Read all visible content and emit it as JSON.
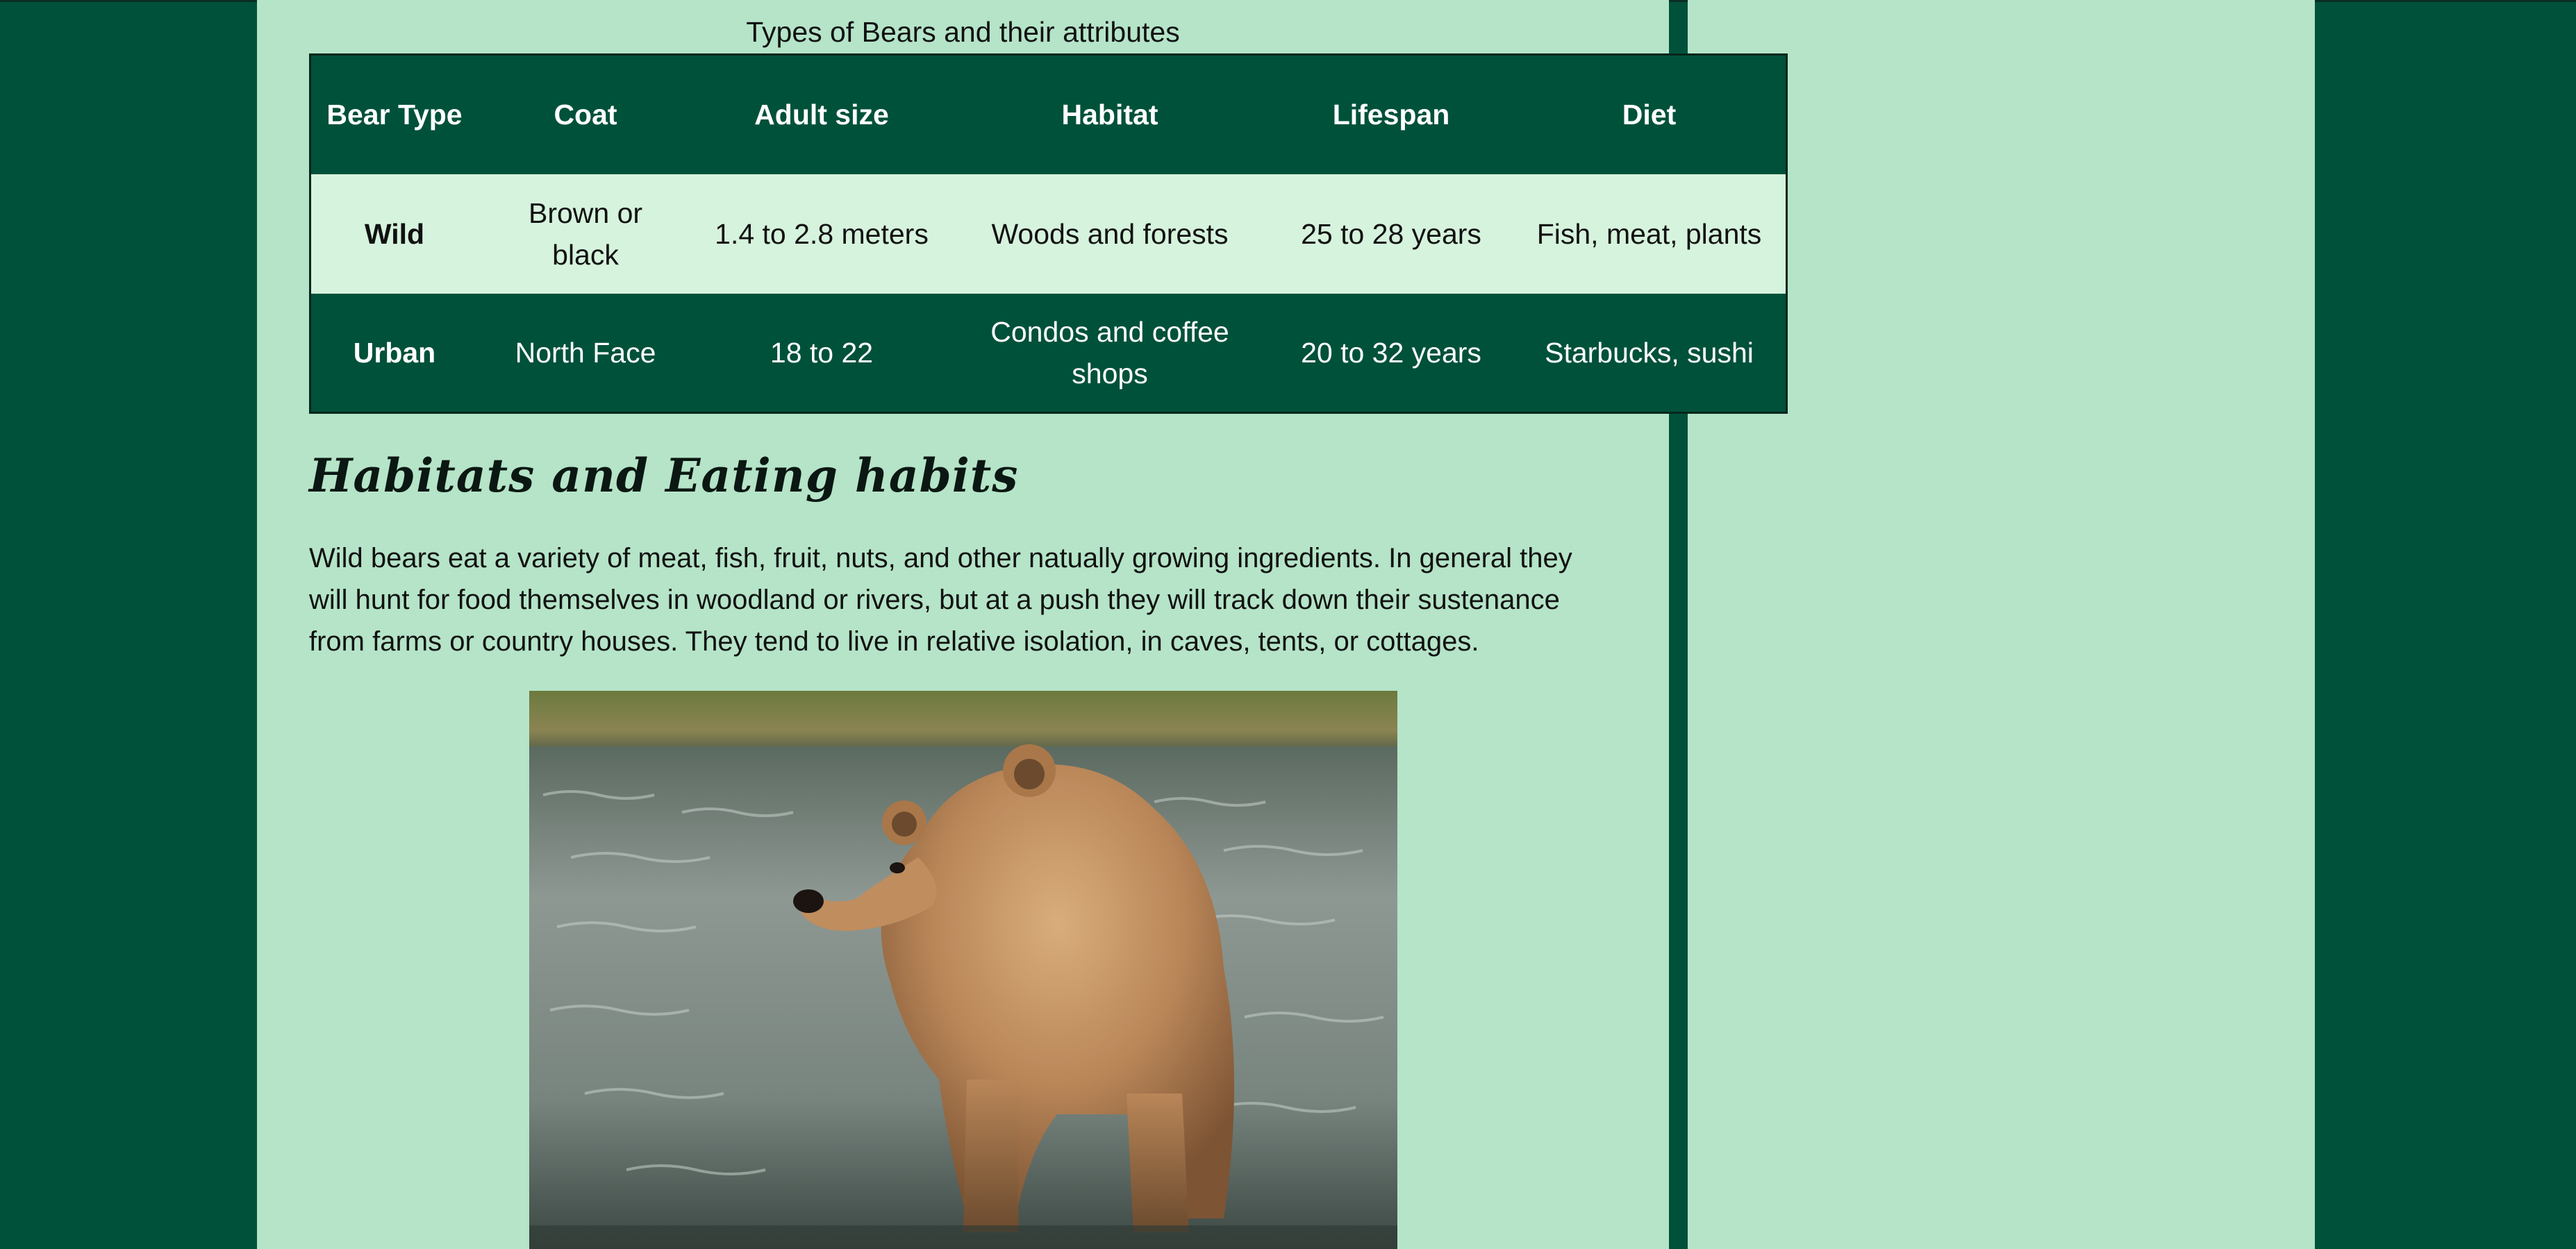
{
  "table": {
    "caption": "Types of Bears and their attributes",
    "headers": [
      "Bear Type",
      "Coat",
      "Adult size",
      "Habitat",
      "Lifespan",
      "Diet"
    ],
    "rows": [
      {
        "type": "Wild",
        "coat": "Brown or black",
        "size": "1.4 to 2.8 meters",
        "habitat": "Woods and forests",
        "lifespan": "25 to 28 years",
        "diet": "Fish, meat, plants"
      },
      {
        "type": "Urban",
        "coat": "North Face",
        "size": "18 to 22",
        "habitat": "Condos and coffee shops",
        "lifespan": "20 to 32 years",
        "diet": "Starbucks, sushi"
      }
    ]
  },
  "section": {
    "heading": "Habitats and Eating habits",
    "paragraph": "Wild bears eat a variety of meat, fish, fruit, nuts, and other natually growing ingredients. In general they will hunt for food themselves in woodland or rivers, but at a push they will track down their sustenance from farms or country houses. They tend to live in relative isolation, in caves, tents, or cottages."
  },
  "colors": {
    "page_background": "#00513a",
    "content_background": "#b5e4c8",
    "table_header": "#00513a",
    "table_light_row": "#d6f3dd"
  },
  "image": {
    "subject": "brown bear standing in river water"
  }
}
